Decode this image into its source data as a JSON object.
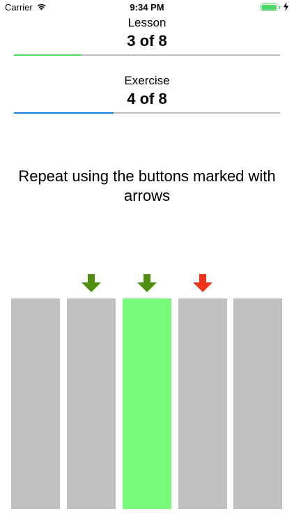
{
  "status_bar": {
    "carrier": "Carrier",
    "time": "9:34 PM",
    "battery_percent": 100,
    "wifi_icon": "wifi-icon",
    "charging_icon": "bolt-icon"
  },
  "lesson": {
    "label": "Lesson",
    "value": "3 of 8",
    "current": 3,
    "total": 8,
    "bar_color": "#4cd964"
  },
  "exercise": {
    "label": "Exercise",
    "value": "4 of 8",
    "current": 4,
    "total": 8,
    "bar_color": "#1f7fd6"
  },
  "instruction": "Repeat using the buttons marked with arrows",
  "keys": [
    {
      "state": "idle",
      "color": "#c0c0c0"
    },
    {
      "state": "idle",
      "color": "#c0c0c0",
      "marker": "green-down-arrow"
    },
    {
      "state": "active",
      "color": "#78f97a",
      "marker": "green-down-arrow"
    },
    {
      "state": "idle",
      "color": "#c0c0c0",
      "marker": "red-down-arrow"
    },
    {
      "state": "idle",
      "color": "#c0c0c0"
    }
  ],
  "colors": {
    "arrow_green": "#4f8f0e",
    "arrow_red": "#f0321b",
    "key_idle": "#c0c0c0",
    "key_active": "#78f97a",
    "track": "#bdbdbd"
  }
}
